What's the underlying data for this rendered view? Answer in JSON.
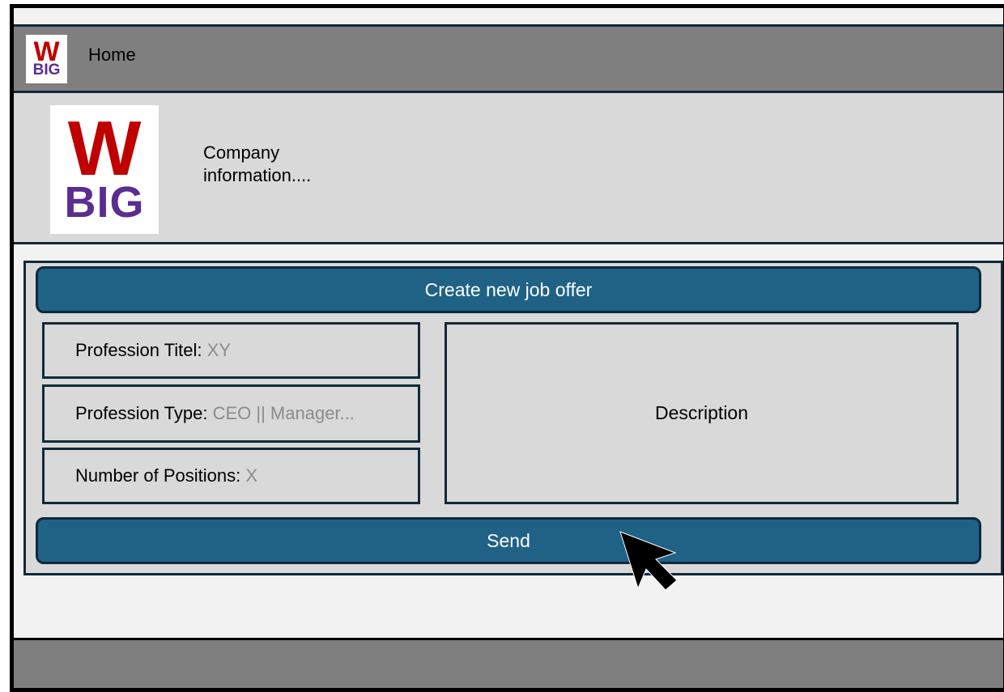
{
  "nav": {
    "logo_text_top": "W",
    "logo_text_bottom": "BIG",
    "home_label": "Home"
  },
  "company": {
    "logo_text_top": "W",
    "logo_text_bottom": "BIG",
    "info_text": "Company information...."
  },
  "form": {
    "header_label": "Create new job offer",
    "fields": [
      {
        "label": "Profession Titel:",
        "value": "XY"
      },
      {
        "label": "Profession Type:",
        "value": "CEO || Manager..."
      },
      {
        "label": "Number of Positions:",
        "value": "X"
      }
    ],
    "description_label": "Description",
    "send_label": "Send"
  },
  "icons": {
    "cursor": "mouse-pointer-icon"
  },
  "colors": {
    "nav_bar": "#7f7f7f",
    "panel": "#d9d9d9",
    "button": "#1f6286",
    "border": "#0f2a3a",
    "logo_red": "#c00000",
    "logo_purple": "#5b2c91",
    "placeholder_gray": "#8c8c8c"
  }
}
